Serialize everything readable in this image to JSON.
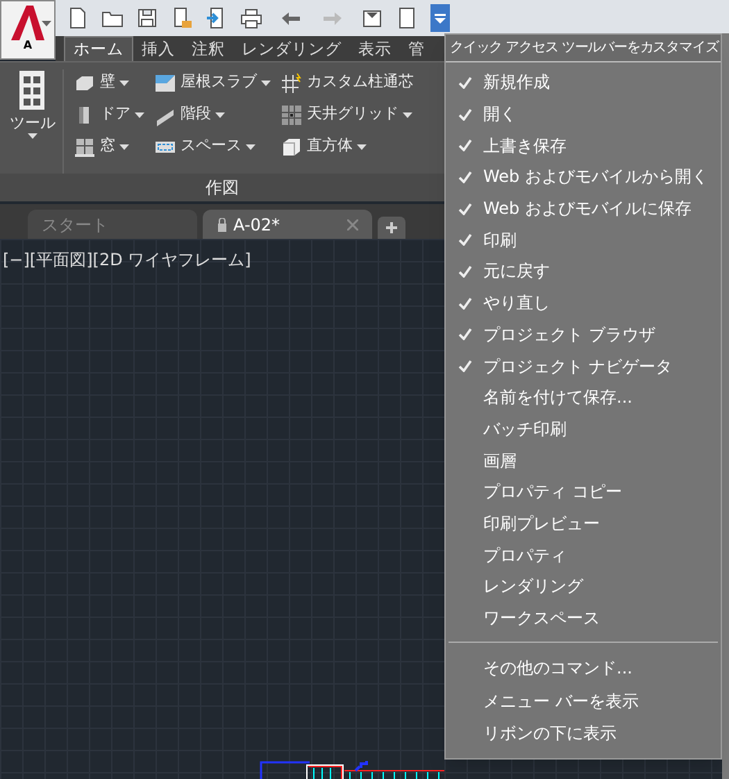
{
  "app_button": {
    "label": "A"
  },
  "ribbon_tabs": [
    {
      "label": "ホーム",
      "selected": true
    },
    {
      "label": "挿入",
      "selected": false
    },
    {
      "label": "注釈",
      "selected": false
    },
    {
      "label": "レンダリング",
      "selected": false
    },
    {
      "label": "表示",
      "selected": false
    },
    {
      "label": "管",
      "selected": false
    }
  ],
  "ribbon_panel": {
    "big_tool": {
      "label": "ツール"
    },
    "columns": [
      [
        {
          "label": "壁",
          "kind": "block"
        },
        {
          "label": "ドア",
          "kind": "door"
        },
        {
          "label": "窓",
          "kind": "window"
        }
      ],
      [
        {
          "label": "屋根スラブ",
          "kind": "roof"
        },
        {
          "label": "階段",
          "kind": "stairs"
        },
        {
          "label": "スペース",
          "kind": "space"
        }
      ],
      [
        {
          "label": "カスタム柱通芯",
          "kind": "grid"
        },
        {
          "label": "天井グリッド",
          "kind": "ceiling"
        },
        {
          "label": "直方体",
          "kind": "box"
        }
      ]
    ],
    "title": "作図"
  },
  "doc_tabs": [
    {
      "label": "スタート",
      "selected": false
    },
    {
      "label": "A-02*",
      "selected": true
    }
  ],
  "viewport_label": "[−][平面図][2D ワイヤフレーム]",
  "menu": {
    "title": "クイック アクセス ツールバーをカスタマイズ",
    "items": [
      {
        "label": "新規作成",
        "checked": true
      },
      {
        "label": "開く",
        "checked": true
      },
      {
        "label": "上書き保存",
        "checked": true
      },
      {
        "label": "Web およびモバイルから開く",
        "checked": true
      },
      {
        "label": "Web およびモバイルに保存",
        "checked": true
      },
      {
        "label": "印刷",
        "checked": true
      },
      {
        "label": "元に戻す",
        "checked": true
      },
      {
        "label": "やり直し",
        "checked": true
      },
      {
        "label": "プロジェクト ブラウザ",
        "checked": true
      },
      {
        "label": "プロジェクト ナビゲータ",
        "checked": true
      },
      {
        "label": "名前を付けて保存...",
        "checked": false
      },
      {
        "label": "バッチ印刷",
        "checked": false
      },
      {
        "label": "画層",
        "checked": false
      },
      {
        "label": "プロパティ コピー",
        "checked": false
      },
      {
        "label": "印刷プレビュー",
        "checked": false
      },
      {
        "label": "プロパティ",
        "checked": false
      },
      {
        "label": "レンダリング",
        "checked": false
      },
      {
        "label": "ワークスペース",
        "checked": false
      }
    ],
    "extra_items": [
      "その他のコマンド...",
      "メニュー バーを表示",
      "リボンの下に表示"
    ]
  }
}
